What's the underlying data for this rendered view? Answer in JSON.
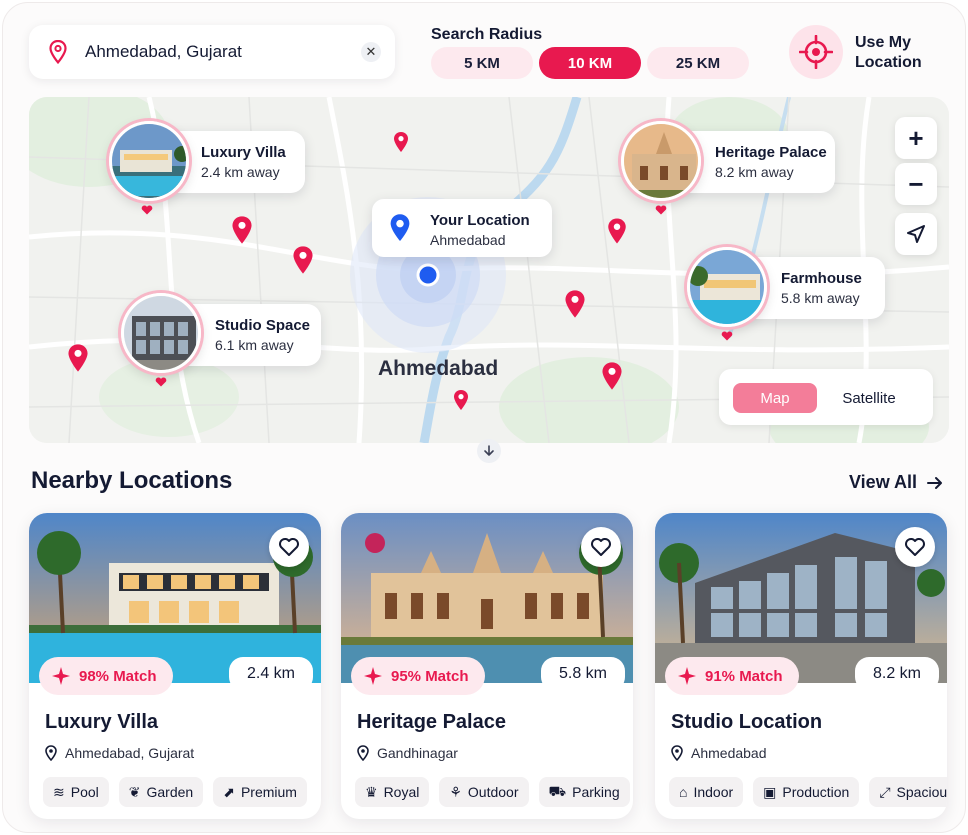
{
  "search": {
    "value": "Ahmedabad, Gujarat",
    "pin_icon": "location-pin-icon",
    "clear_icon": "close-icon"
  },
  "radius": {
    "label": "Search Radius",
    "options": [
      "5 KM",
      "10 KM",
      "25 KM"
    ],
    "selected": "10 KM"
  },
  "use_location": {
    "label_line1": "Use My",
    "label_line2": "Location",
    "icon": "crosshair-icon"
  },
  "map": {
    "city_label": "Ahmedabad",
    "you": {
      "title": "Your Location",
      "subtitle": "Ahmedabad"
    },
    "places": [
      {
        "title": "Luxury Villa",
        "distance": "2.4 km away"
      },
      {
        "title": "Heritage Palace",
        "distance": "8.2 km away"
      },
      {
        "title": "Studio Space",
        "distance": "6.1 km away"
      },
      {
        "title": "Farmhouse",
        "distance": "5.8 km away"
      }
    ],
    "controls": {
      "zoom_in": "+",
      "zoom_out": "−"
    },
    "view_toggle": {
      "map": "Map",
      "satellite": "Satellite",
      "selected": "Map"
    }
  },
  "nearby": {
    "title": "Nearby Locations",
    "view_all": "View All",
    "cards": [
      {
        "name": "Luxury Villa",
        "match": "98% Match",
        "distance": "2.4 km",
        "location": "Ahmedabad, Gujarat",
        "tags": [
          "Pool",
          "Garden",
          "Premium"
        ]
      },
      {
        "name": "Heritage Palace",
        "match": "95% Match",
        "distance": "5.8 km",
        "location": "Gandhinagar",
        "tags": [
          "Royal",
          "Outdoor",
          "Parking"
        ]
      },
      {
        "name": "Studio Location",
        "match": "91% Match",
        "distance": "8.2 km",
        "location": "Ahmedabad",
        "tags": [
          "Indoor",
          "Production",
          "Spacious"
        ]
      }
    ]
  },
  "colors": {
    "accent": "#e8194f",
    "accent_soft": "#fde9ee",
    "text": "#141a33",
    "user_blue": "#1f5cf0"
  }
}
